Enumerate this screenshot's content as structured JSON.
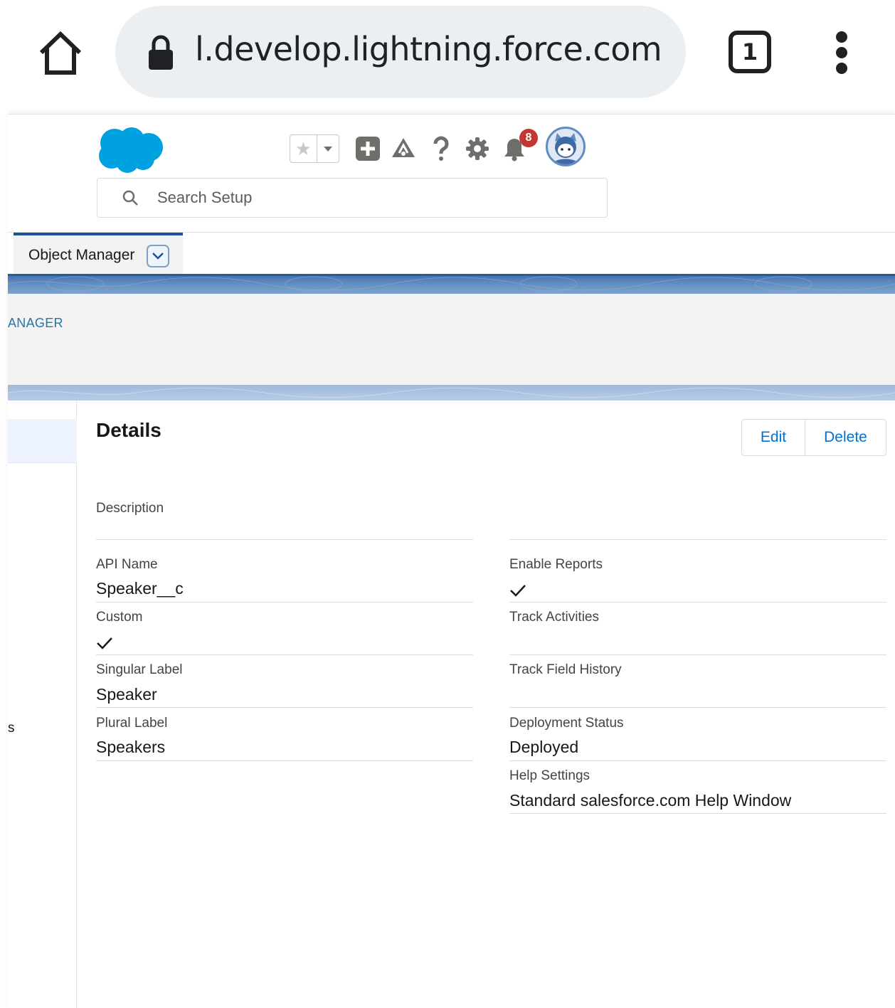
{
  "browser": {
    "url": "l.develop.lightning.force.com",
    "tab_count": "1"
  },
  "header": {
    "search_placeholder": "Search Setup",
    "notification_count": "8"
  },
  "nav": {
    "active_tab": "Object Manager"
  },
  "breadcrumb": "ANAGER",
  "sidebar": {
    "partial_item": "s"
  },
  "details": {
    "title": "Details",
    "edit_label": "Edit",
    "delete_label": "Delete",
    "left_fields": [
      {
        "label": "Description",
        "value": ""
      },
      {
        "label": "API Name",
        "value": "Speaker__c"
      },
      {
        "label": "Custom",
        "value": "checked"
      },
      {
        "label": "Singular Label",
        "value": "Speaker"
      },
      {
        "label": "Plural Label",
        "value": "Speakers"
      }
    ],
    "right_fields": [
      {
        "label": "Enable Reports",
        "value": "checked"
      },
      {
        "label": "Track Activities",
        "value": ""
      },
      {
        "label": "Track Field History",
        "value": ""
      },
      {
        "label": "Deployment Status",
        "value": "Deployed"
      },
      {
        "label": "Help Settings",
        "value": "Standard salesforce.com Help Window"
      }
    ]
  },
  "colors": {
    "brand_blue": "#1b5297",
    "link_blue": "#0070d2",
    "logo_blue": "#00a1e0",
    "badge_red": "#c23934"
  }
}
